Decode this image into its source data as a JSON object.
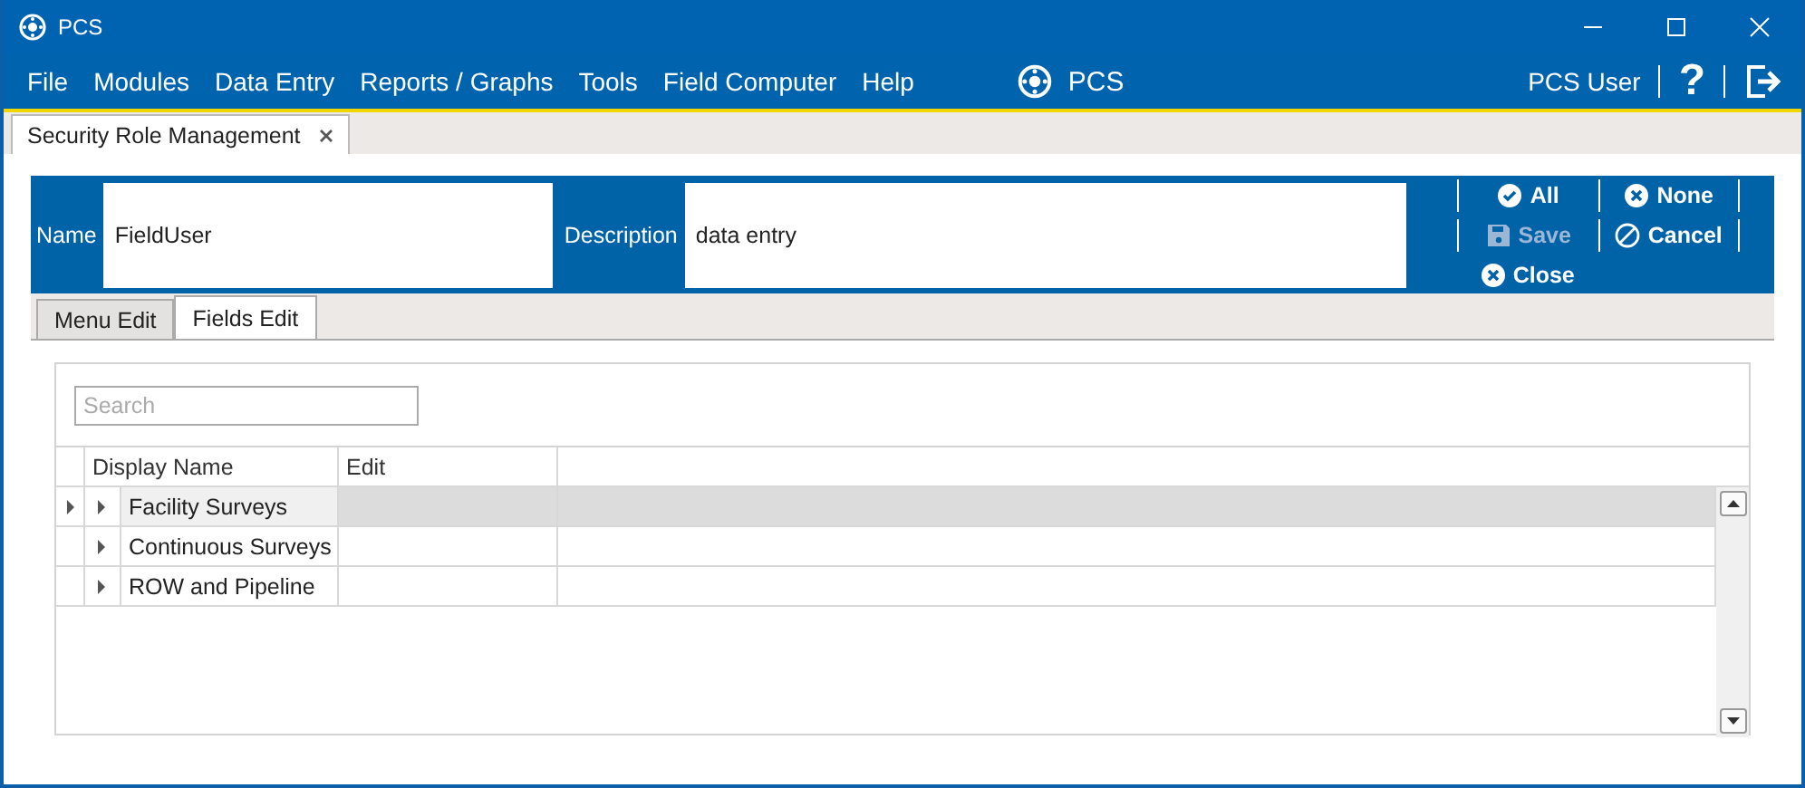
{
  "window": {
    "title": "PCS"
  },
  "menu": [
    "File",
    "Modules",
    "Data Entry",
    "Reports / Graphs",
    "Tools",
    "Field Computer",
    "Help"
  ],
  "brand": "PCS",
  "user": "PCS User",
  "help": "?",
  "doc_tabs": [
    {
      "label": "Security Role Management",
      "selected": true
    }
  ],
  "form": {
    "name_label": "Name",
    "name_value": "FieldUser",
    "description_label": "Description",
    "description_value": "data entry"
  },
  "actions": [
    {
      "kind": "all",
      "label": "All",
      "disabled": false
    },
    {
      "kind": "none",
      "label": "None",
      "disabled": false
    },
    {
      "kind": "save",
      "label": "Save",
      "disabled": true
    },
    {
      "kind": "cancel",
      "label": "Cancel",
      "disabled": false
    },
    {
      "kind": "close",
      "label": "Close",
      "disabled": false
    }
  ],
  "tabs": [
    {
      "label": "Menu Edit",
      "selected": false
    },
    {
      "label": "Fields Edit",
      "selected": true
    }
  ],
  "search": {
    "placeholder": "Search"
  },
  "table": {
    "columns": [
      "Display Name",
      "Edit"
    ],
    "rows": [
      {
        "name": "Facility Surveys",
        "selected": true,
        "expanded": false
      },
      {
        "name": "Continuous Surveys",
        "selected": false,
        "expanded": false
      },
      {
        "name": "ROW and Pipeline",
        "selected": false,
        "expanded": false
      }
    ]
  }
}
